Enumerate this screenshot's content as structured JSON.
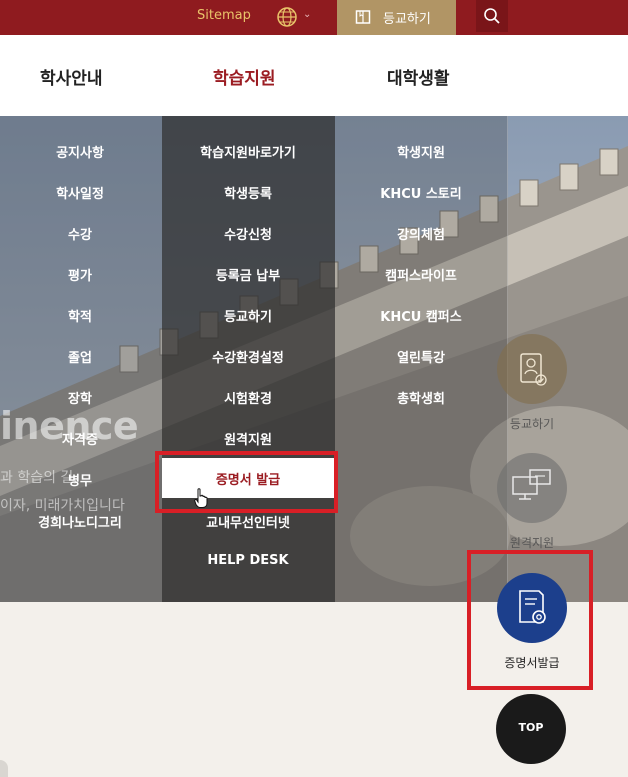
{
  "topbar": {
    "sitemap_label": "Sitemap",
    "language_icon": "globe-icon",
    "enroll_label": "등교하기",
    "search_icon": "search-icon"
  },
  "main_nav": {
    "tabs": [
      {
        "label": "학사안내",
        "active": false
      },
      {
        "label": "학습지원",
        "active": true
      },
      {
        "label": "대학생활",
        "active": false
      }
    ]
  },
  "menu": {
    "col1": [
      "공지사항",
      "학사일정",
      "수강",
      "평가",
      "학적",
      "졸업",
      "장학",
      "자격증",
      "병무",
      "경희나노디그리"
    ],
    "col2": [
      "학습지원바로가기",
      "학생등록",
      "수강신청",
      "등록금 납부",
      "등교하기",
      "수강환경설정",
      "시험환경",
      "원격지원",
      "증명서 발급",
      "교내무선인터넷",
      "HELP DESK"
    ],
    "col3": [
      "학생지원",
      "KHCU 스토리",
      "강의체험",
      "캠퍼스라이프",
      "KHCU 캠퍼스",
      "열린특강",
      "총학생회"
    ],
    "highlighted": "증명서 발급"
  },
  "background_text": {
    "big": "inence",
    "line1": "과 학습의 길,",
    "line2": "이자, 미래가치입니다"
  },
  "quick_links": [
    {
      "label": "등교하기",
      "icon": "student-id-icon"
    },
    {
      "label": "원격지원",
      "icon": "remote-support-icon"
    },
    {
      "label": "증명서발급",
      "icon": "certificate-icon"
    }
  ],
  "top_button": "TOP",
  "colors": {
    "brand_red": "#8f1b1f",
    "gold": "#b19565",
    "highlight_frame": "#d81f26",
    "certificate_blue": "#1c3f8c"
  }
}
